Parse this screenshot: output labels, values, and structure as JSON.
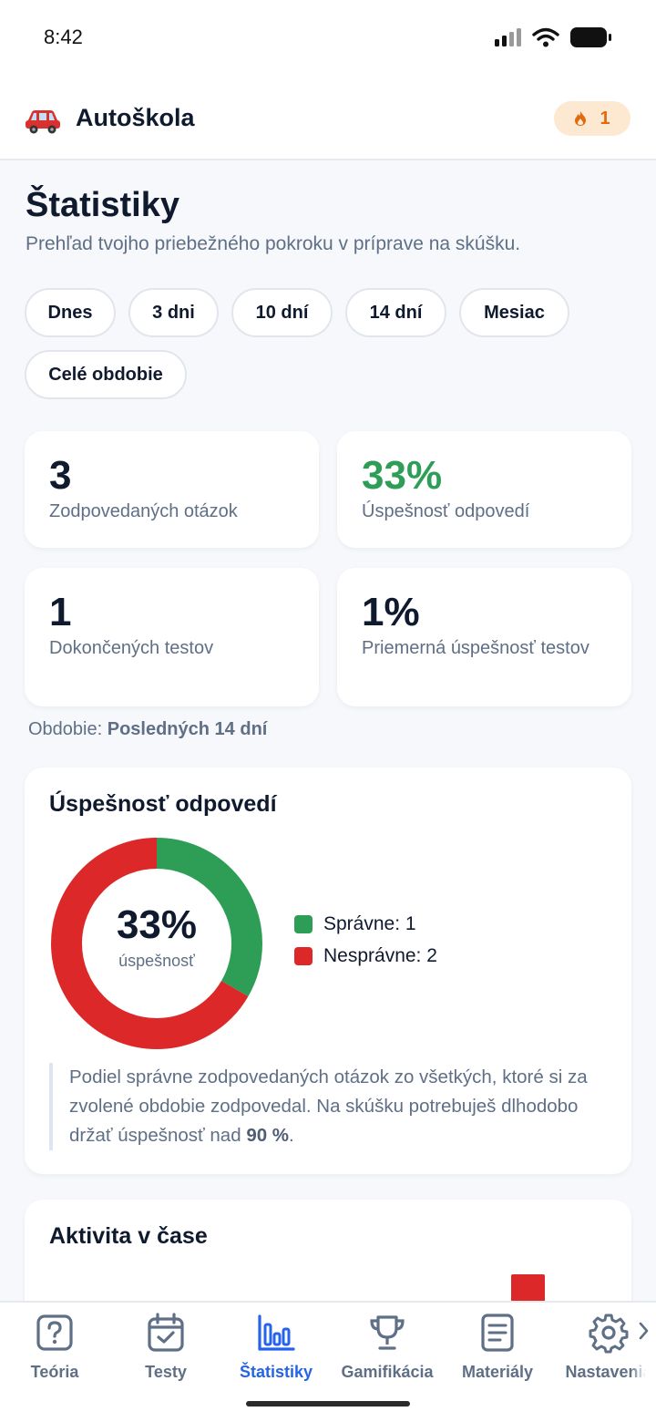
{
  "status_bar": {
    "time": "8:42"
  },
  "header": {
    "title": "Autoškola",
    "streak_count": "1",
    "icons": {
      "logo": "car-icon",
      "streak": "flame-icon"
    }
  },
  "page": {
    "title": "Štatistiky",
    "subtitle": "Prehľad tvojho priebežného pokroku v príprave na skúšku."
  },
  "filters": [
    "Dnes",
    "3 dni",
    "10 dní",
    "14 dní",
    "Mesiac",
    "Celé obdobie"
  ],
  "stats": [
    {
      "value": "3",
      "label": "Zodpovedaných otázok"
    },
    {
      "value": "33%",
      "label": "Úspešnosť odpovedí"
    },
    {
      "value": "1",
      "label": "Dokončených testov"
    },
    {
      "value": "1%",
      "label": "Priemerná úspešnosť testov"
    }
  ],
  "period": {
    "prefix": "Obdobie:",
    "value": "Posledných 14 dní"
  },
  "success_card": {
    "title": "Úspešnosť odpovedí",
    "center_value": "33%",
    "center_label": "úspešnosť",
    "legend": [
      "Správne: 1",
      "Nesprávne: 2"
    ],
    "note_text": "Podiel správne zodpovedaných otázok zo všetkých, ktoré si za zvolené obdobie zodpovedal. Na skúšku potrebuješ dlhodobo držať úspešnosť nad",
    "note_bold": "90 %",
    "note_end": "."
  },
  "chart_data": {
    "type": "pie",
    "categories": [
      "Správne",
      "Nesprávne"
    ],
    "values": [
      1,
      2
    ],
    "colors": [
      "#2e9e57",
      "#dc2828"
    ]
  },
  "activity": {
    "title": "Aktivita v čase"
  },
  "bottom_nav": [
    {
      "label": "Teória",
      "icon": "question-icon"
    },
    {
      "label": "Testy",
      "icon": "calendar-check-icon"
    },
    {
      "label": "Štatistiky",
      "icon": "bar-chart-icon",
      "active": true
    },
    {
      "label": "Gamifikácia",
      "icon": "trophy-icon"
    },
    {
      "label": "Materiály",
      "icon": "document-icon"
    },
    {
      "label": "Nastavenia",
      "icon": "gear-icon"
    }
  ],
  "colors": {
    "accent": "#2563eb",
    "success": "#2e9e57",
    "error": "#dc2828"
  }
}
